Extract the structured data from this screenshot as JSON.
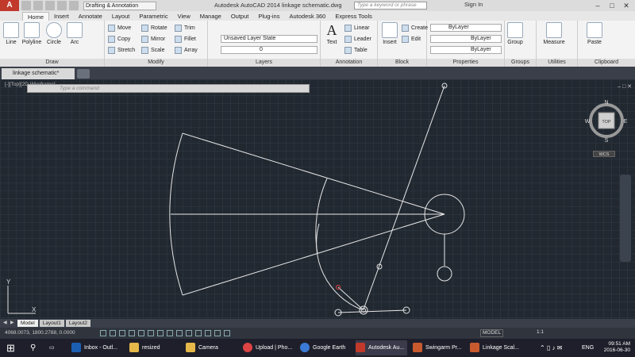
{
  "titlebar": {
    "workspace": "Drafting & Annotation",
    "title": "Autodesk AutoCAD 2014   linkage schematic.dwg",
    "search_placeholder": "Type a keyword or phrase",
    "signin": "Sign In"
  },
  "ribbon_tabs": [
    "Home",
    "Insert",
    "Annotate",
    "Layout",
    "Parametric",
    "View",
    "Manage",
    "Output",
    "Plug-ins",
    "Autodesk 360",
    "Express Tools"
  ],
  "draw": {
    "title": "Draw",
    "line": "Line",
    "polyline": "Polyline",
    "circle": "Circle",
    "arc": "Arc"
  },
  "modify": {
    "title": "Modify",
    "move": "Move",
    "rotate": "Rotate",
    "trim": "Trim",
    "copy": "Copy",
    "mirror": "Mirror",
    "fillet": "Fillet",
    "stretch": "Stretch",
    "scale": "Scale",
    "array": "Array"
  },
  "layers": {
    "title": "Layers",
    "layer_state": "Unsaved Layer State",
    "current_layer": "0"
  },
  "annotation": {
    "title": "Annotation",
    "text": "Text",
    "linear": "Linear",
    "leader": "Leader",
    "table": "Table"
  },
  "block": {
    "title": "Block",
    "insert": "Insert",
    "create": "Create",
    "edit": "Edit"
  },
  "properties": {
    "title": "Properties",
    "color": "ByLayer",
    "linetype": "ByLayer",
    "lineweight": "ByLayer"
  },
  "groups": {
    "title": "Groups",
    "group": "Group"
  },
  "utilities": {
    "title": "Utilities",
    "measure": "Measure"
  },
  "clipboard": {
    "title": "Clipboard",
    "paste": "Paste"
  },
  "file_tab": "linkage schematic*",
  "viewport": {
    "label": "[-][Top][2D Wireframe]",
    "cmd_placeholder": "Type a command",
    "viewcube": {
      "top": "TOP",
      "n": "N",
      "s": "S",
      "e": "E",
      "w": "W",
      "wcs": "WCS"
    }
  },
  "layout_tabs": [
    "Model",
    "Layout1",
    "Layout2"
  ],
  "status": {
    "coords": "4068.0073, 1800.2788, 0.0000",
    "model": "MODEL",
    "scale": "1:1"
  },
  "taskbar": {
    "items": [
      "Inbox - Outl...",
      "resized",
      "Camera",
      "Upload | Pho...",
      "Google Earth",
      "Autodesk Au...",
      "Swingarm Pr...",
      "Linkage Scal..."
    ],
    "lang": "ENG",
    "time": "09:51 AM",
    "date": "2016-06-30"
  }
}
